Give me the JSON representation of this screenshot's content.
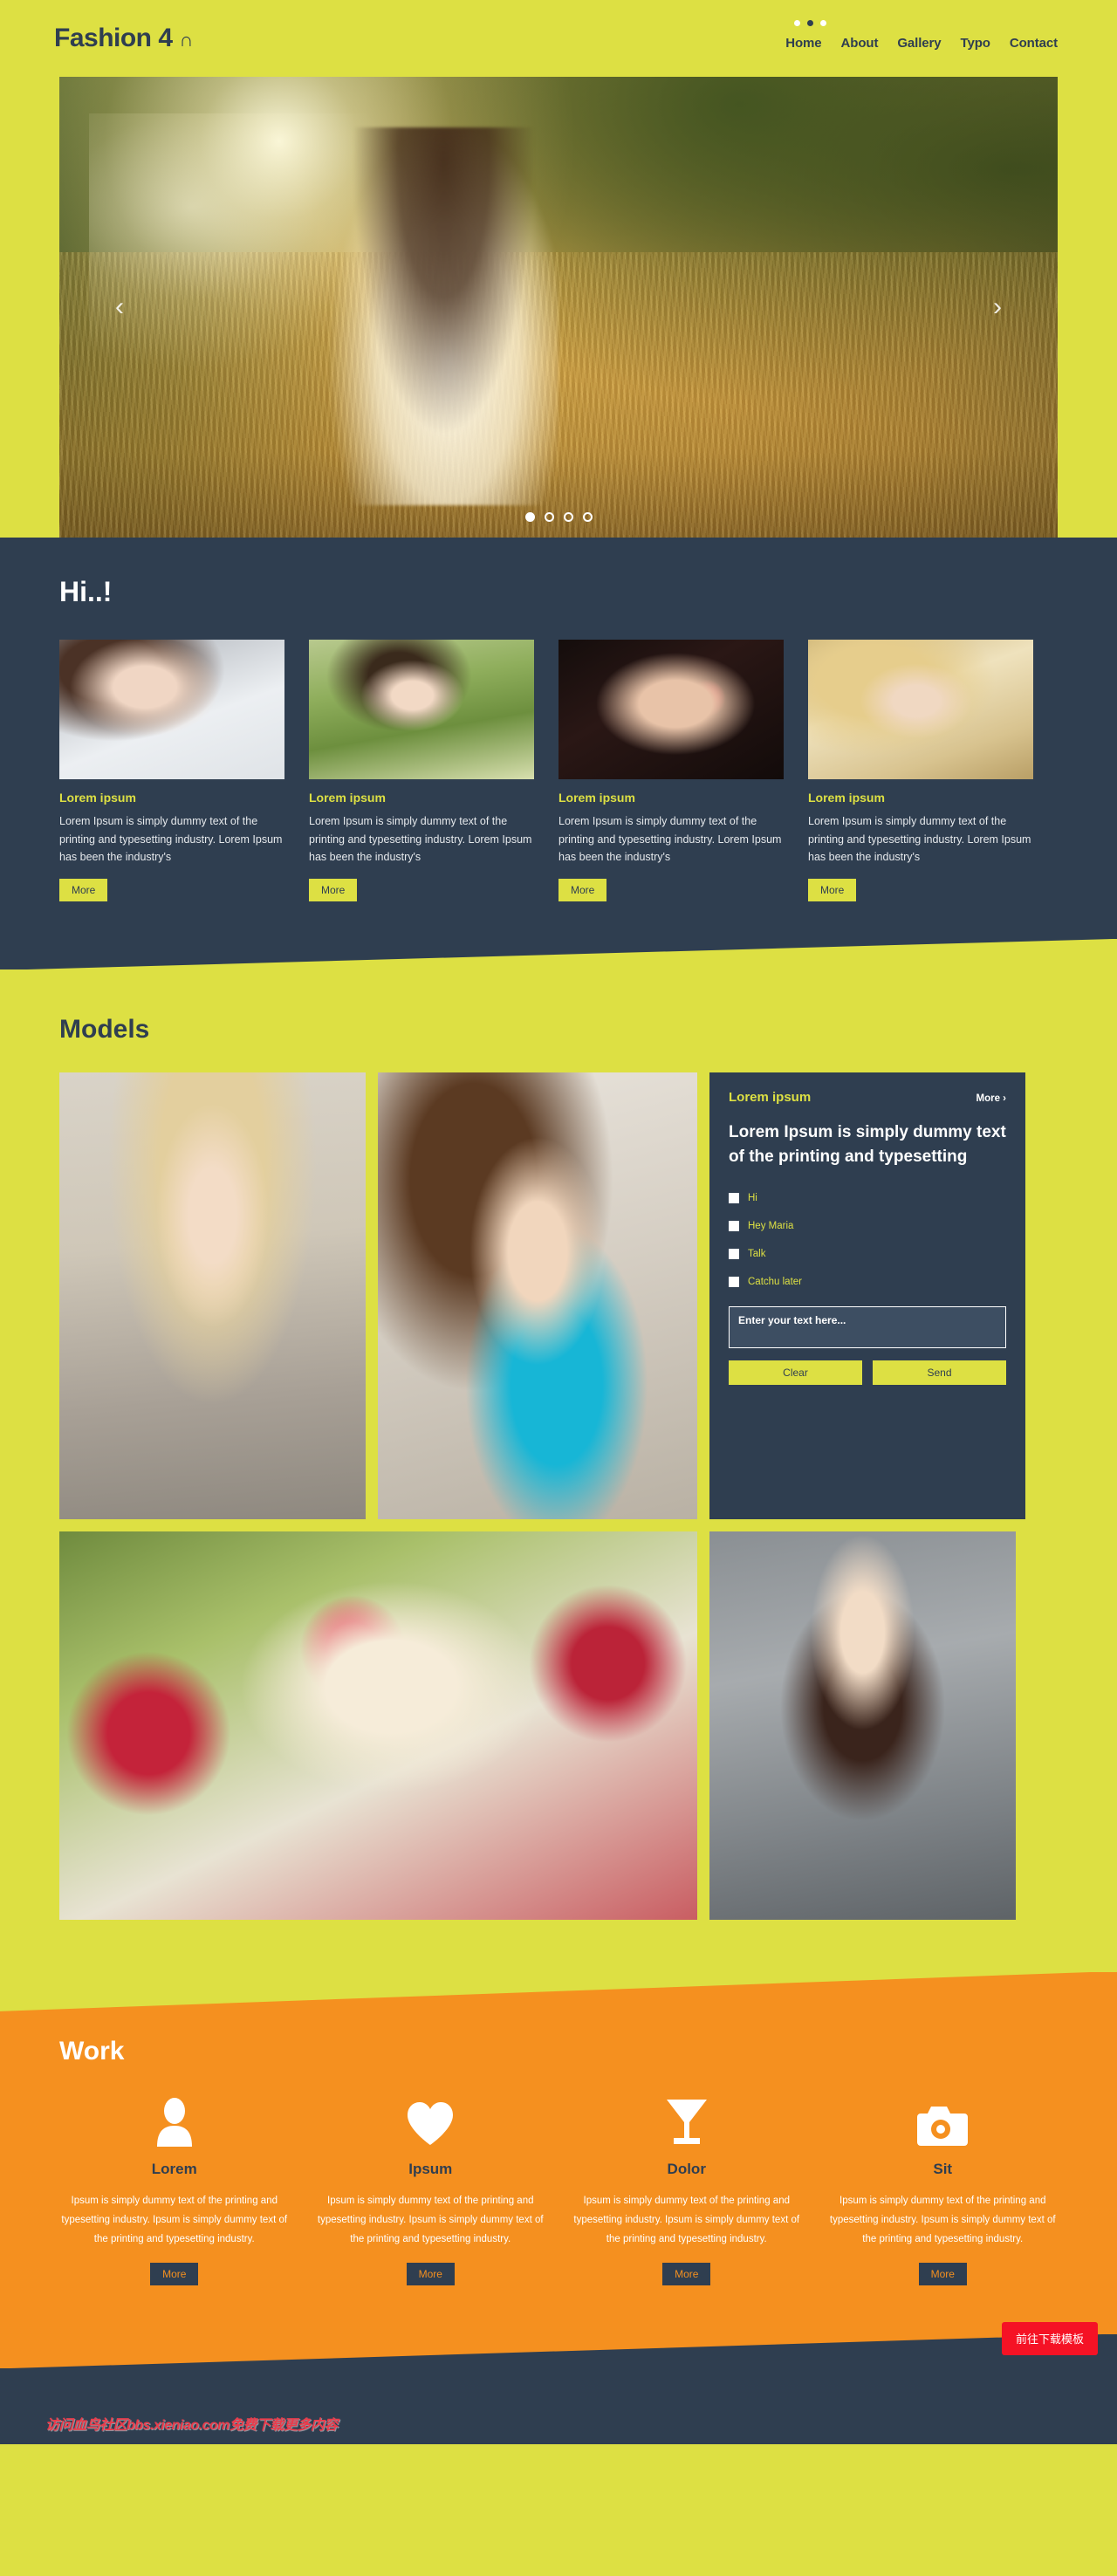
{
  "header": {
    "logo_text": "Fashion 4",
    "logo_mark": "∩",
    "nav": [
      {
        "label": "Home"
      },
      {
        "label": "About"
      },
      {
        "label": "Gallery"
      },
      {
        "label": "Typo"
      },
      {
        "label": "Contact"
      }
    ]
  },
  "hero": {
    "prev_icon": "‹",
    "next_icon": "›",
    "slides": 4,
    "active_slide": 1
  },
  "hi": {
    "title": "Hi..!",
    "cards": [
      {
        "heading": "Lorem ipsum",
        "body": "Lorem Ipsum is simply dummy text of the printing and typesetting industry. Lorem Ipsum has been the industry's",
        "button": "More"
      },
      {
        "heading": "Lorem ipsum",
        "body": "Lorem Ipsum is simply dummy text of the printing and typesetting industry. Lorem Ipsum has been the industry's",
        "button": "More"
      },
      {
        "heading": "Lorem ipsum",
        "body": "Lorem Ipsum is simply dummy text of the printing and typesetting industry. Lorem Ipsum has been the industry's",
        "button": "More"
      },
      {
        "heading": "Lorem ipsum",
        "body": "Lorem Ipsum is simply dummy text of the printing and typesetting industry. Lorem Ipsum has been the industry's",
        "button": "More"
      }
    ]
  },
  "models": {
    "title": "Models",
    "panel": {
      "label": "Lorem ipsum",
      "more": "More  ›",
      "heading": "Lorem Ipsum is simply dummy text of the printing and typesetting",
      "options": [
        {
          "label": "Hi"
        },
        {
          "label": "Hey Maria"
        },
        {
          "label": "Talk"
        },
        {
          "label": "Catchu later"
        }
      ],
      "input_placeholder": "Enter your text here...",
      "input_value": "",
      "clear_label": "Clear",
      "send_label": "Send"
    }
  },
  "work": {
    "title": "Work",
    "columns": [
      {
        "icon": "person-icon",
        "heading": "Lorem",
        "body": "Ipsum is simply dummy text of the printing and typesetting industry. Ipsum is simply dummy text of the printing and typesetting industry.",
        "button": "More"
      },
      {
        "icon": "heart-icon",
        "heading": "Ipsum",
        "body": "Ipsum is simply dummy text of the printing and typesetting industry. Ipsum is simply dummy text of the printing and typesetting industry.",
        "button": "More"
      },
      {
        "icon": "cocktail-icon",
        "heading": "Dolor",
        "body": "Ipsum is simply dummy text of the printing and typesetting industry. Ipsum is simply dummy text of the printing and typesetting industry.",
        "button": "More"
      },
      {
        "icon": "camera-icon",
        "heading": "Sit",
        "body": "Ipsum is simply dummy text of the printing and typesetting industry. Ipsum is simply dummy text of the printing and typesetting industry.",
        "button": "More"
      }
    ]
  },
  "footer": {
    "watermark": "访问血鸟社区bbs.xieniao.com免费下载更多内容",
    "download_button": "前往下载模板"
  },
  "colors": {
    "yellow": "#dde043",
    "dark_navy": "#2f3e50",
    "orange": "#f5901f",
    "red": "#f51225",
    "watermark_red": "#ea3b4b"
  }
}
